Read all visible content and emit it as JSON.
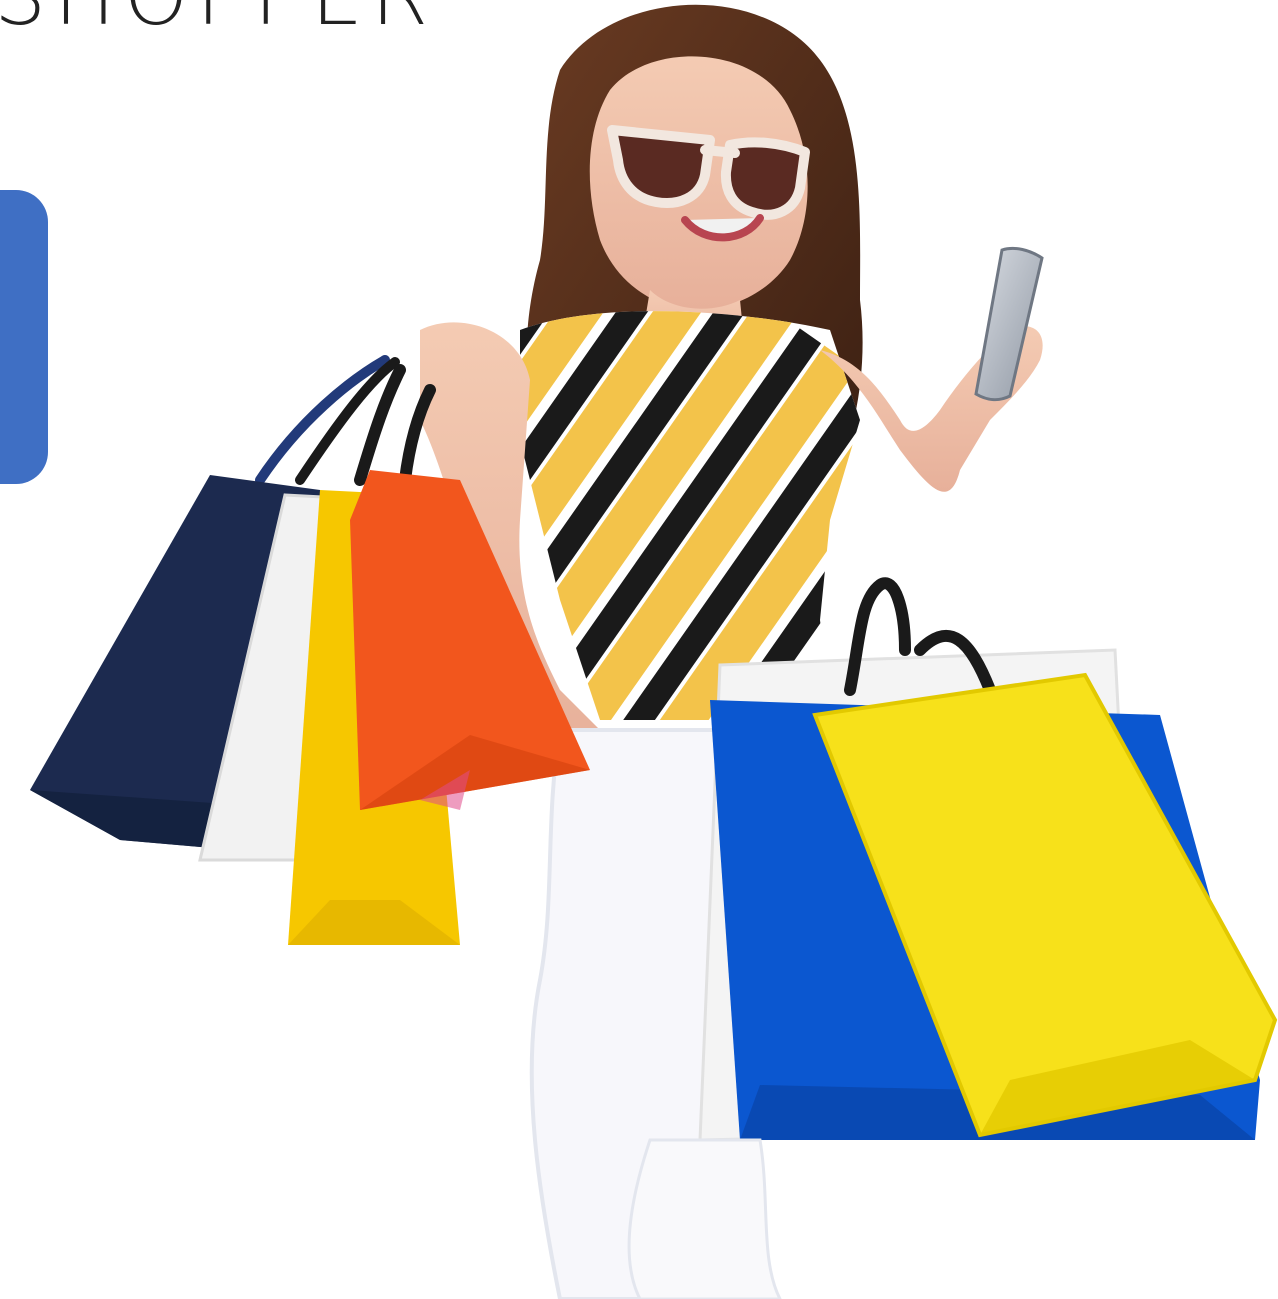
{
  "header": {
    "headline_text": "SHOPPER"
  },
  "side_tab": {
    "color": "#3f6fc4"
  },
  "hero": {
    "subject": "woman-with-shopping-bags",
    "bag_colors": [
      "#1c2a4f",
      "#f2f2f2",
      "#f6c700",
      "#f2561d",
      "#0b57d0",
      "#f7e11a"
    ],
    "top_stripe_colors": [
      "#1a1a1a",
      "#f3c34a",
      "#ffffff"
    ]
  }
}
